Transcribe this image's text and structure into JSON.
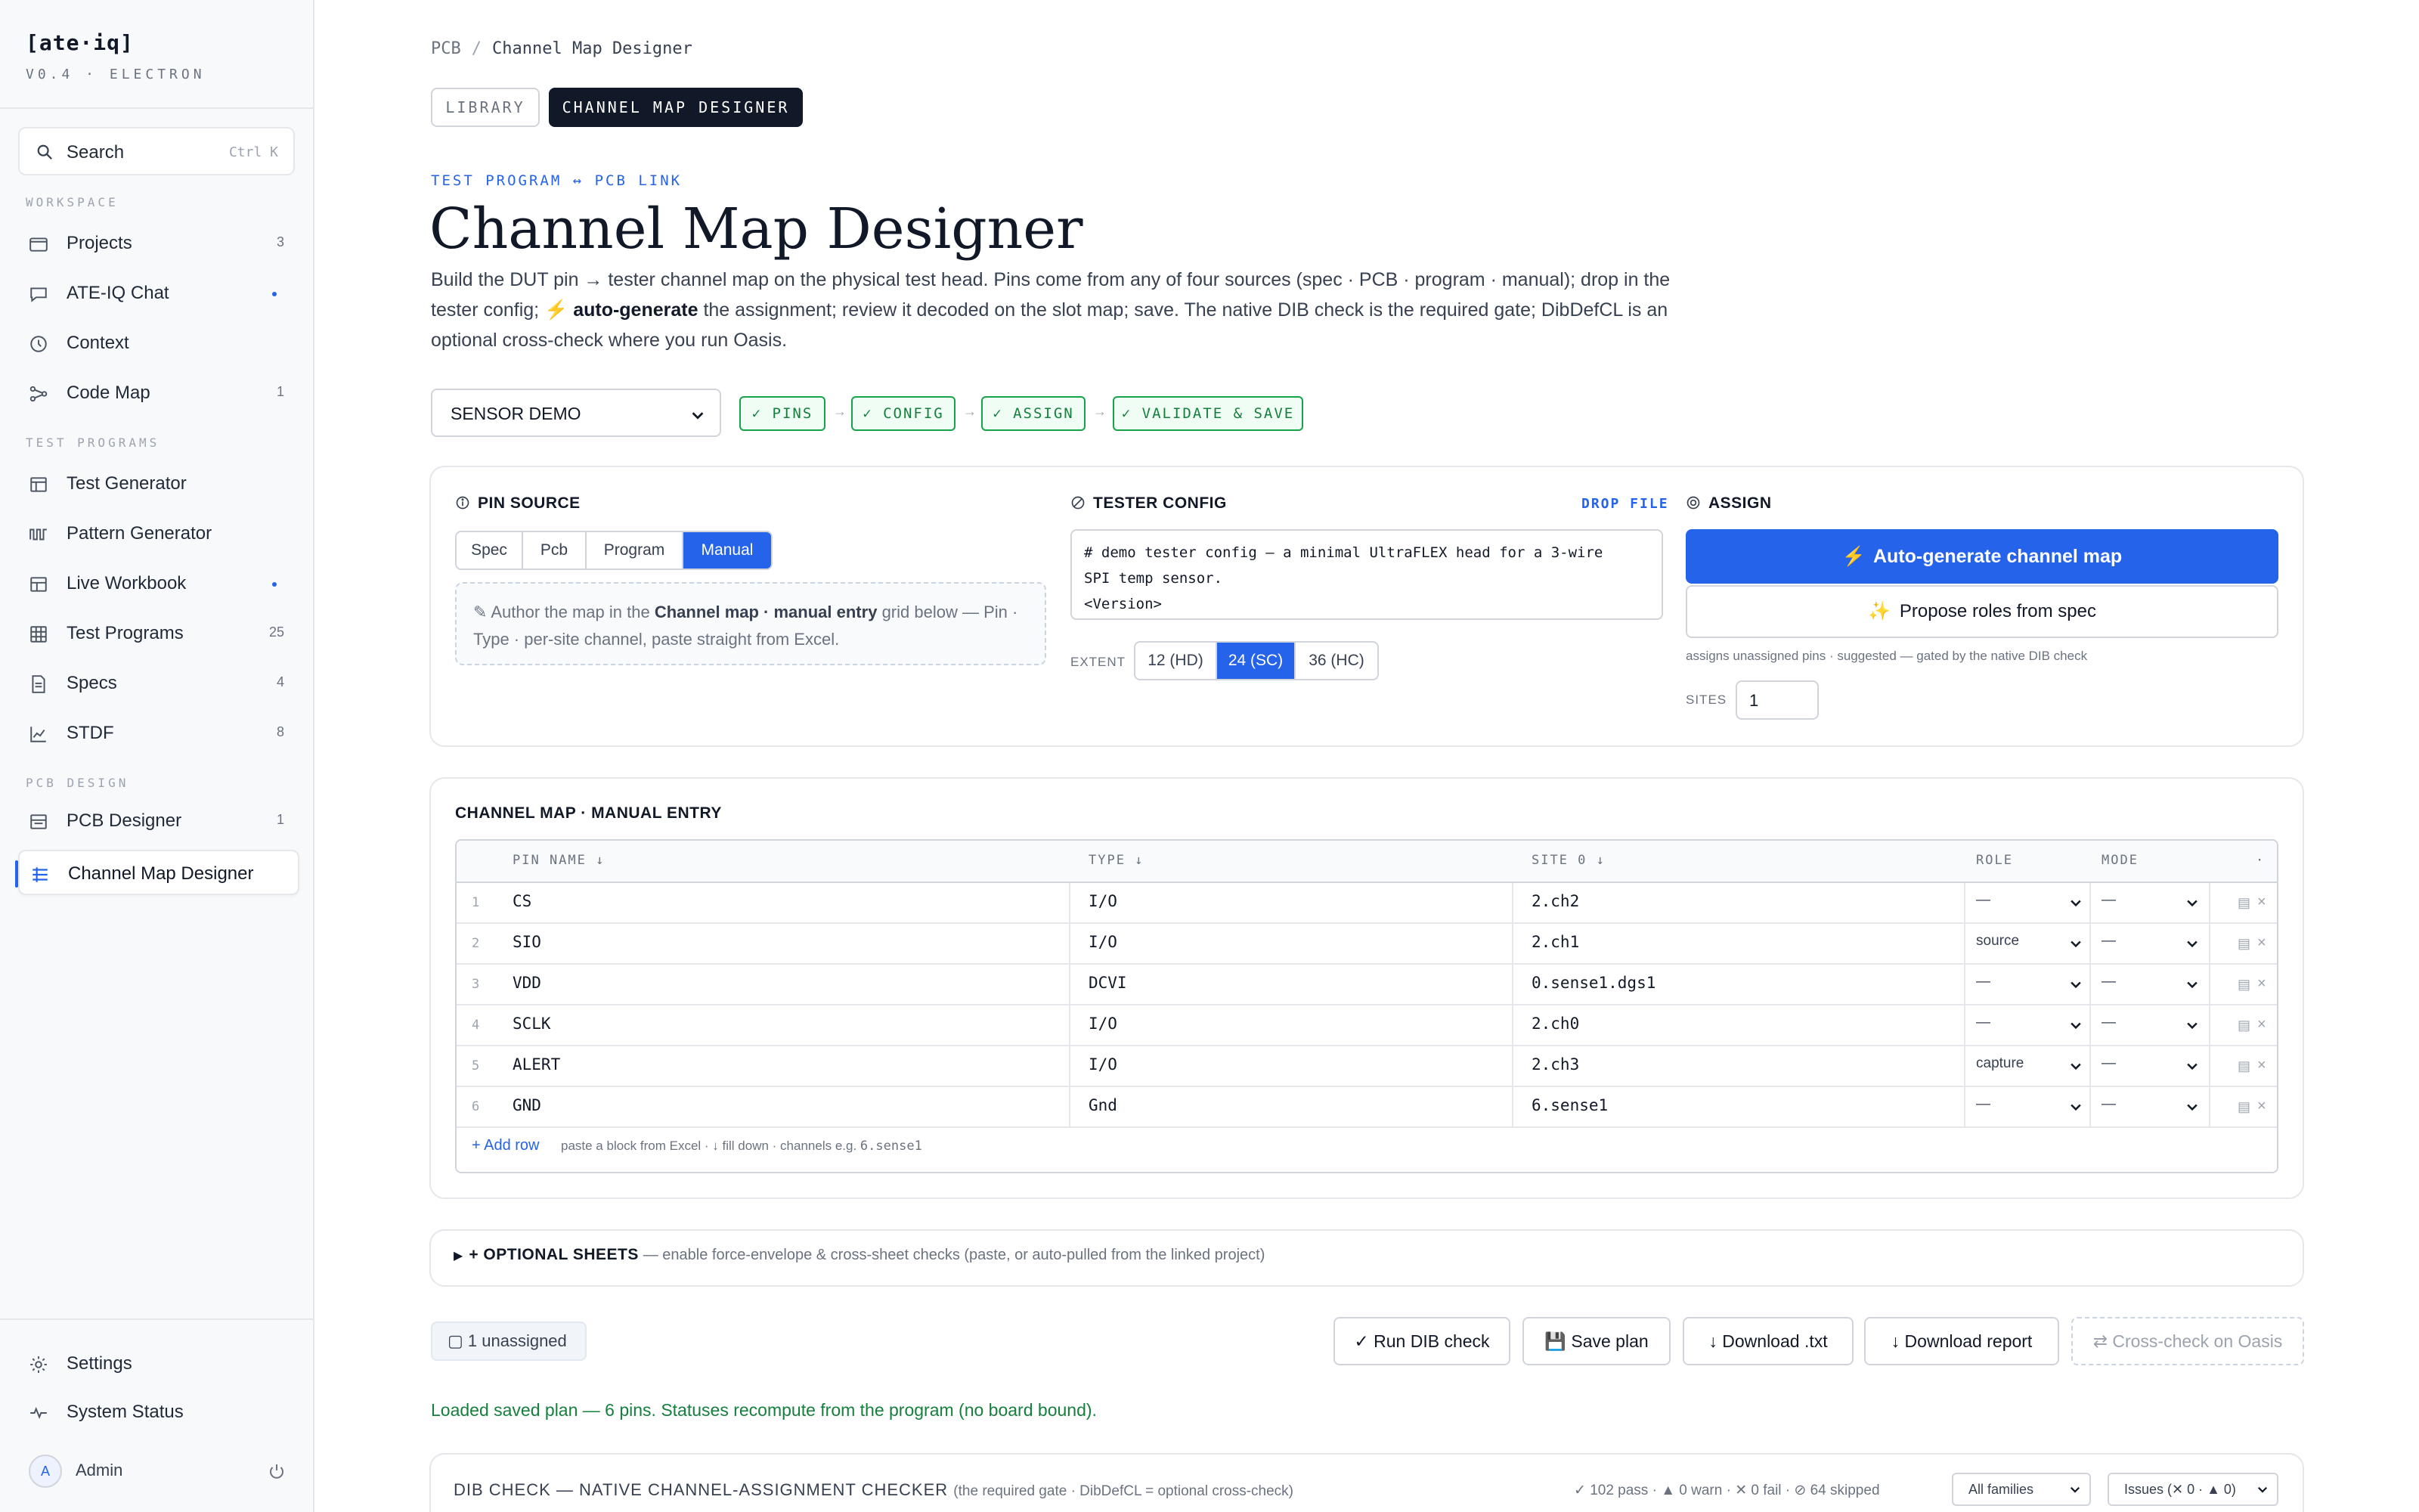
{
  "app": {
    "brand": "[ate·iq]",
    "version": "V0.4 · ELECTRON"
  },
  "sidebar": {
    "search": {
      "label": "Search",
      "shortcut": "Ctrl K"
    },
    "sections": {
      "workspace": "WORKSPACE",
      "test_programs": "TEST PROGRAMS",
      "pcb_design": "PCB DESIGN"
    },
    "workspace": [
      {
        "label": "Projects",
        "count": "3",
        "icon": "folder-icon"
      },
      {
        "label": "ATE-IQ Chat",
        "count": "•",
        "icon": "chat-icon"
      },
      {
        "label": "Context",
        "count": "",
        "icon": "clock-icon"
      },
      {
        "label": "Code Map",
        "count": "1",
        "icon": "graph-icon"
      }
    ],
    "test_programs": [
      {
        "label": "Test Generator",
        "count": "",
        "icon": "table-icon"
      },
      {
        "label": "Pattern Generator",
        "count": "",
        "icon": "waveform-icon"
      },
      {
        "label": "Live Workbook",
        "count": "•",
        "icon": "grid-icon"
      },
      {
        "label": "Test Programs",
        "count": "25",
        "icon": "grid-icon"
      },
      {
        "label": "Specs",
        "count": "4",
        "icon": "document-icon"
      },
      {
        "label": "STDF",
        "count": "8",
        "icon": "chart-icon"
      }
    ],
    "pcb_design": [
      {
        "label": "PCB Designer",
        "count": "1",
        "icon": "board-icon"
      },
      {
        "label": "Channel Map Designer",
        "count": "",
        "icon": "list-icon"
      }
    ],
    "bottom": [
      {
        "label": "Settings",
        "icon": "gear-icon"
      },
      {
        "label": "System Status",
        "icon": "pulse-icon"
      }
    ],
    "user": {
      "initial": "A",
      "name": "Admin"
    }
  },
  "breadcrumb": {
    "root": "PCB",
    "separator": "/",
    "current": "Channel Map Designer"
  },
  "tabs": {
    "library": "LIBRARY",
    "designer": "CHANNEL MAP DESIGNER"
  },
  "header": {
    "eyebrow": "TEST PROGRAM ↔ PCB LINK",
    "title": "Channel Map Designer",
    "desc_1": "Build the DUT pin → tester channel map on the physical test head. Pins come from any of four sources (spec · PCB · program · manual); drop in the tester config;",
    "desc_bold": "auto-generate",
    "desc_2": "the assignment; review it decoded on the slot map; save. The native DIB check is the required gate; DibDefCL is an optional cross-check where you run Oasis."
  },
  "workflow": {
    "demo_select": "SENSOR DEMO",
    "steps": [
      "✓ PINS",
      "✓ CONFIG",
      "✓ ASSIGN",
      "✓ VALIDATE & SAVE"
    ],
    "arrow": "→"
  },
  "pin_source": {
    "heading": "PIN SOURCE",
    "options": [
      "Spec",
      "Pcb",
      "Program",
      "Manual"
    ],
    "selected": "Manual",
    "hint_1": "✎ Author the map in the",
    "hint_bold": "Channel map · manual entry",
    "hint_2": "grid below — Pin · Type · per-site channel, paste straight from Excel."
  },
  "tester_config": {
    "heading": "TESTER CONFIG",
    "drop_file": "DROP FILE",
    "config_lines": [
      "# demo tester config — a minimal UltraFLEX head for a 3-wire",
      "SPI temp sensor.",
      "<Version>"
    ],
    "extent_label": "EXTENT",
    "extent_options": [
      "12 (HD)",
      "24 (SC)",
      "36 (HC)"
    ],
    "extent_selected": "24 (SC)"
  },
  "assign": {
    "heading": "ASSIGN",
    "auto_generate": "Auto-generate channel map",
    "propose_roles": "Propose roles from spec",
    "note": "assigns unassigned pins · suggested — gated by the native DIB check",
    "sites_label": "SITES",
    "sites_value": "1"
  },
  "channel_map": {
    "heading": "CHANNEL MAP · MANUAL ENTRY",
    "columns": {
      "pin": "PIN NAME ↓",
      "type": "TYPE ↓",
      "site": "SITE 0 ↓",
      "role": "ROLE",
      "mode": "MODE",
      "more": "·"
    },
    "rows": [
      {
        "n": "1",
        "pin": "CS",
        "type": "I/O",
        "site": "2.ch2",
        "role": "—",
        "mode": "—"
      },
      {
        "n": "2",
        "pin": "SIO",
        "type": "I/O",
        "site": "2.ch1",
        "role": "source",
        "mode": "—"
      },
      {
        "n": "3",
        "pin": "VDD",
        "type": "DCVI",
        "site": "0.sense1.dgs1",
        "role": "—",
        "mode": "—"
      },
      {
        "n": "4",
        "pin": "SCLK",
        "type": "I/O",
        "site": "2.ch0",
        "role": "—",
        "mode": "—"
      },
      {
        "n": "5",
        "pin": "ALERT",
        "type": "I/O",
        "site": "2.ch3",
        "role": "capture",
        "mode": "—"
      },
      {
        "n": "6",
        "pin": "GND",
        "type": "Gnd",
        "site": "6.sense1",
        "role": "—",
        "mode": "—"
      }
    ],
    "add_row": "+ Add row",
    "add_row_hint_1": "paste a block from Excel · ↓ fill down · channels e.g.",
    "add_row_hint_code": "6.sense1"
  },
  "optional_sheets": {
    "toggle": "▶",
    "label": "+ OPTIONAL SHEETS",
    "desc": "— enable force-envelope & cross-sheet checks (paste, or auto-pulled from the linked project)"
  },
  "actions": {
    "unassigned": "▢ 1 unassigned",
    "run_dib": "✓ Run DIB check",
    "save_plan": "💾 Save plan",
    "download_txt": "↓ Download .txt",
    "download_report": "↓ Download report",
    "cross_check": "⇄ Cross-check on Oasis"
  },
  "status": {
    "loaded": "Loaded saved plan — 6 pins. Statuses recompute from the program (no board bound)."
  },
  "dib": {
    "title": "DIB CHECK — NATIVE CHANNEL-ASSIGNMENT CHECKER",
    "subtitle": "(the required gate · DibDefCL = optional cross-check)",
    "stats": "✓ 102 pass · ▲ 0 warn · ✕ 0 fail · ⊘ 64 skipped",
    "family_filter": "All families",
    "issues_filter": "Issues (✕ 0 · ▲ 0)"
  },
  "colors": {
    "accent": "#2563eb",
    "success": "#16a34a",
    "dark": "#111827",
    "warning": "#f97316"
  }
}
